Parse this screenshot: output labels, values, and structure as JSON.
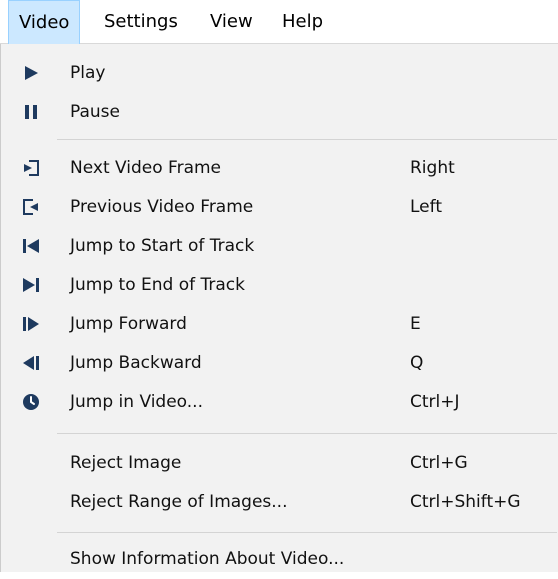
{
  "menubar": {
    "items": [
      {
        "label": "Video"
      },
      {
        "label": "Settings"
      },
      {
        "label": "View"
      },
      {
        "label": "Help"
      }
    ]
  },
  "menu": {
    "items": [
      {
        "icon": "play-icon",
        "label": "Play",
        "shortcut": ""
      },
      {
        "icon": "pause-icon",
        "label": "Pause",
        "shortcut": ""
      },
      {
        "icon": "next-frame-icon",
        "label": "Next Video Frame",
        "shortcut": "Right"
      },
      {
        "icon": "previous-frame-icon",
        "label": "Previous Video Frame",
        "shortcut": "Left"
      },
      {
        "icon": "jump-to-start-icon",
        "label": "Jump to Start of Track",
        "shortcut": ""
      },
      {
        "icon": "jump-to-end-icon",
        "label": "Jump to End of Track",
        "shortcut": ""
      },
      {
        "icon": "jump-forward-icon",
        "label": "Jump Forward",
        "shortcut": "E"
      },
      {
        "icon": "jump-backward-icon",
        "label": "Jump Backward",
        "shortcut": "Q"
      },
      {
        "icon": "clock-icon",
        "label": "Jump in Video...",
        "shortcut": "Ctrl+J"
      },
      {
        "icon": "",
        "label": "Reject Image",
        "shortcut": "Ctrl+G"
      },
      {
        "icon": "",
        "label": "Reject Range of Images...",
        "shortcut": "Ctrl+Shift+G"
      },
      {
        "icon": "",
        "label": "Show Information About Video...",
        "shortcut": ""
      }
    ]
  },
  "colors": {
    "menubar_active_bg": "#cce8ff",
    "menu_bg": "#f2f2f2",
    "icon_color": "#1e3a5f"
  }
}
